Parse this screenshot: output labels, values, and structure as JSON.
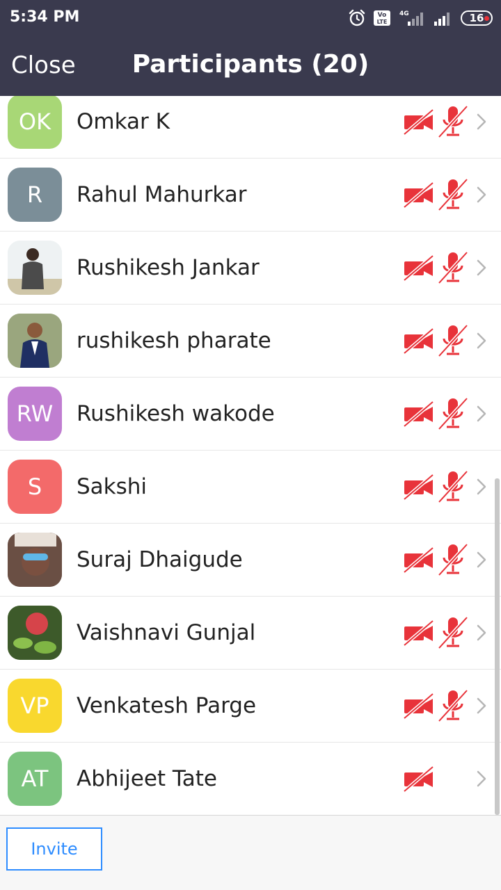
{
  "status_bar": {
    "time": "5:34 PM",
    "network": "4G",
    "volte": "Vo LTE",
    "battery": "16"
  },
  "header": {
    "close_label": "Close",
    "title": "Participants (20)"
  },
  "participants": [
    {
      "name": "Omkar K",
      "initials": "OK",
      "avatar_color": "#a8d776",
      "avatar": "initials",
      "video_off": true,
      "mic_muted": true
    },
    {
      "name": "Rahul Mahurkar",
      "initials": "R",
      "avatar_color": "#7b8e98",
      "avatar": "initials",
      "video_off": true,
      "mic_muted": true
    },
    {
      "name": "Rushikesh Jankar",
      "initials": "",
      "avatar_color": "#e9eef0",
      "avatar": "photo",
      "video_off": true,
      "mic_muted": true
    },
    {
      "name": "rushikesh pharate",
      "initials": "",
      "avatar_color": "#8f9c73",
      "avatar": "photo",
      "video_off": true,
      "mic_muted": true
    },
    {
      "name": "Rushikesh wakode",
      "initials": "RW",
      "avatar_color": "#c07ed1",
      "avatar": "initials",
      "video_off": true,
      "mic_muted": true
    },
    {
      "name": "Sakshi",
      "initials": "S",
      "avatar_color": "#f36a6a",
      "avatar": "initials",
      "video_off": true,
      "mic_muted": true
    },
    {
      "name": "Suraj Dhaigude",
      "initials": "",
      "avatar_color": "#6b5148",
      "avatar": "photo",
      "video_off": true,
      "mic_muted": true
    },
    {
      "name": "Vaishnavi Gunjal",
      "initials": "",
      "avatar_color": "#5f7d3e",
      "avatar": "photo",
      "video_off": true,
      "mic_muted": true
    },
    {
      "name": "Venkatesh Parge",
      "initials": "VP",
      "avatar_color": "#f9d82e",
      "avatar": "initials",
      "video_off": true,
      "mic_muted": true
    },
    {
      "name": "Abhijeet Tate",
      "initials": "AT",
      "avatar_color": "#7cc47f",
      "avatar": "initials",
      "video_off": true,
      "mic_muted": false
    }
  ],
  "footer": {
    "invite_label": "Invite"
  },
  "colors": {
    "header_bg": "#3a3a4e",
    "muted_icon": "#e8333a",
    "accent": "#2d8cff"
  }
}
